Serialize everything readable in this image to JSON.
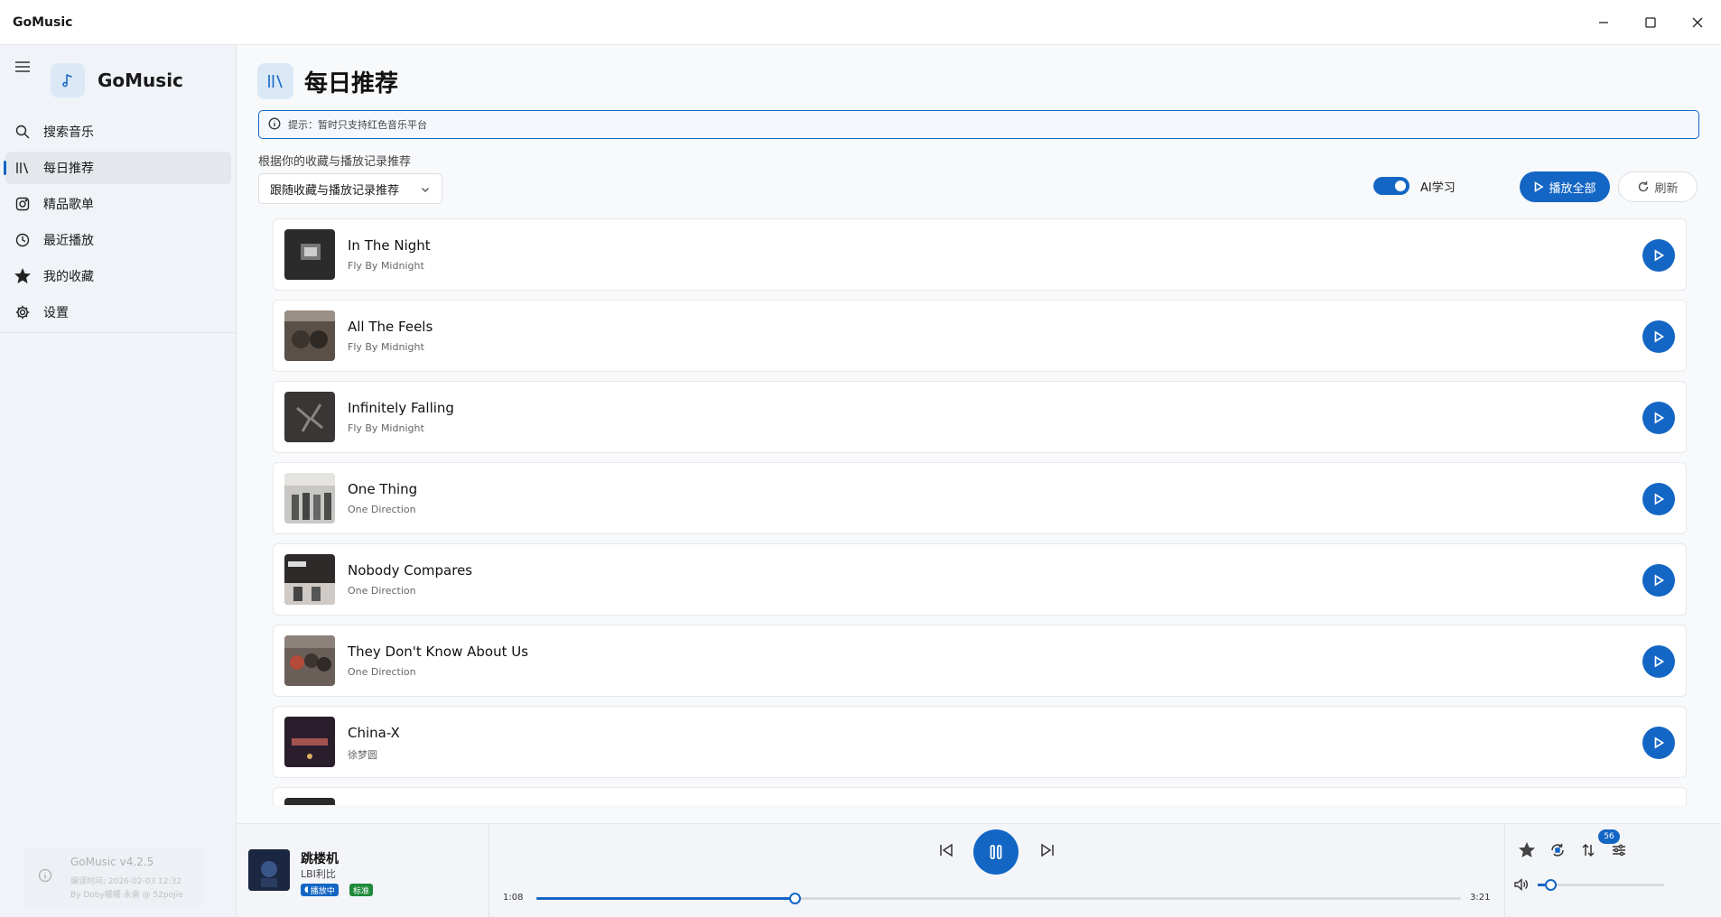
{
  "window": {
    "title": "GoMusic"
  },
  "sidebar": {
    "brand": "GoMusic",
    "items": [
      {
        "label": "搜索音乐",
        "icon": "search-icon",
        "active": false
      },
      {
        "label": "每日推荐",
        "icon": "library-icon",
        "active": true
      },
      {
        "label": "精品歌单",
        "icon": "playlist-icon",
        "active": false
      },
      {
        "label": "最近播放",
        "icon": "clock-icon",
        "active": false
      },
      {
        "label": "我的收藏",
        "icon": "star-icon",
        "active": false
      },
      {
        "label": "设置",
        "icon": "gear-icon",
        "active": false
      }
    ],
    "version": {
      "title": "GoMusic v4.2.5",
      "line1": "编译时间: 2026-02-03 12:32",
      "line2": "By Doby暖暖·永雷 @ 52pojie"
    }
  },
  "main": {
    "title": "每日推荐",
    "notice": "提示：暂时只支持红色音乐平台",
    "rec_label": "根据你的收藏与播放记录推荐",
    "dropdown_value": "跟随收藏与播放记录推荐",
    "ai_label": "AI学习",
    "ai_enabled": true,
    "play_all": "播放全部",
    "refresh": "刷新",
    "songs": [
      {
        "title": "In The Night",
        "artist": "Fly By Midnight",
        "cover": "#2b2b2b"
      },
      {
        "title": "All The Feels",
        "artist": "Fly By Midnight",
        "cover": "#5a5048"
      },
      {
        "title": "Infinitely Falling",
        "artist": "Fly By Midnight",
        "cover": "#3a3636"
      },
      {
        "title": "One Thing",
        "artist": "One Direction",
        "cover": "#8e8c88"
      },
      {
        "title": "Nobody Compares",
        "artist": "One Direction",
        "cover": "#4a4444"
      },
      {
        "title": "They Don't Know About Us",
        "artist": "One Direction",
        "cover": "#6a5e58"
      },
      {
        "title": "China-X",
        "artist": "徐梦圆",
        "cover": "#2a1e2c"
      }
    ]
  },
  "player": {
    "title": "跳楼机",
    "artist": "LBI利比",
    "badge_playing": "播放中",
    "badge_quality": "标准",
    "current_time": "1:08",
    "total_time": "3:21",
    "progress": 0.279,
    "queue_count": "56",
    "volume": 0.1
  },
  "colors": {
    "accent": "#1466c4",
    "quality_green": "#1e8a3a"
  }
}
